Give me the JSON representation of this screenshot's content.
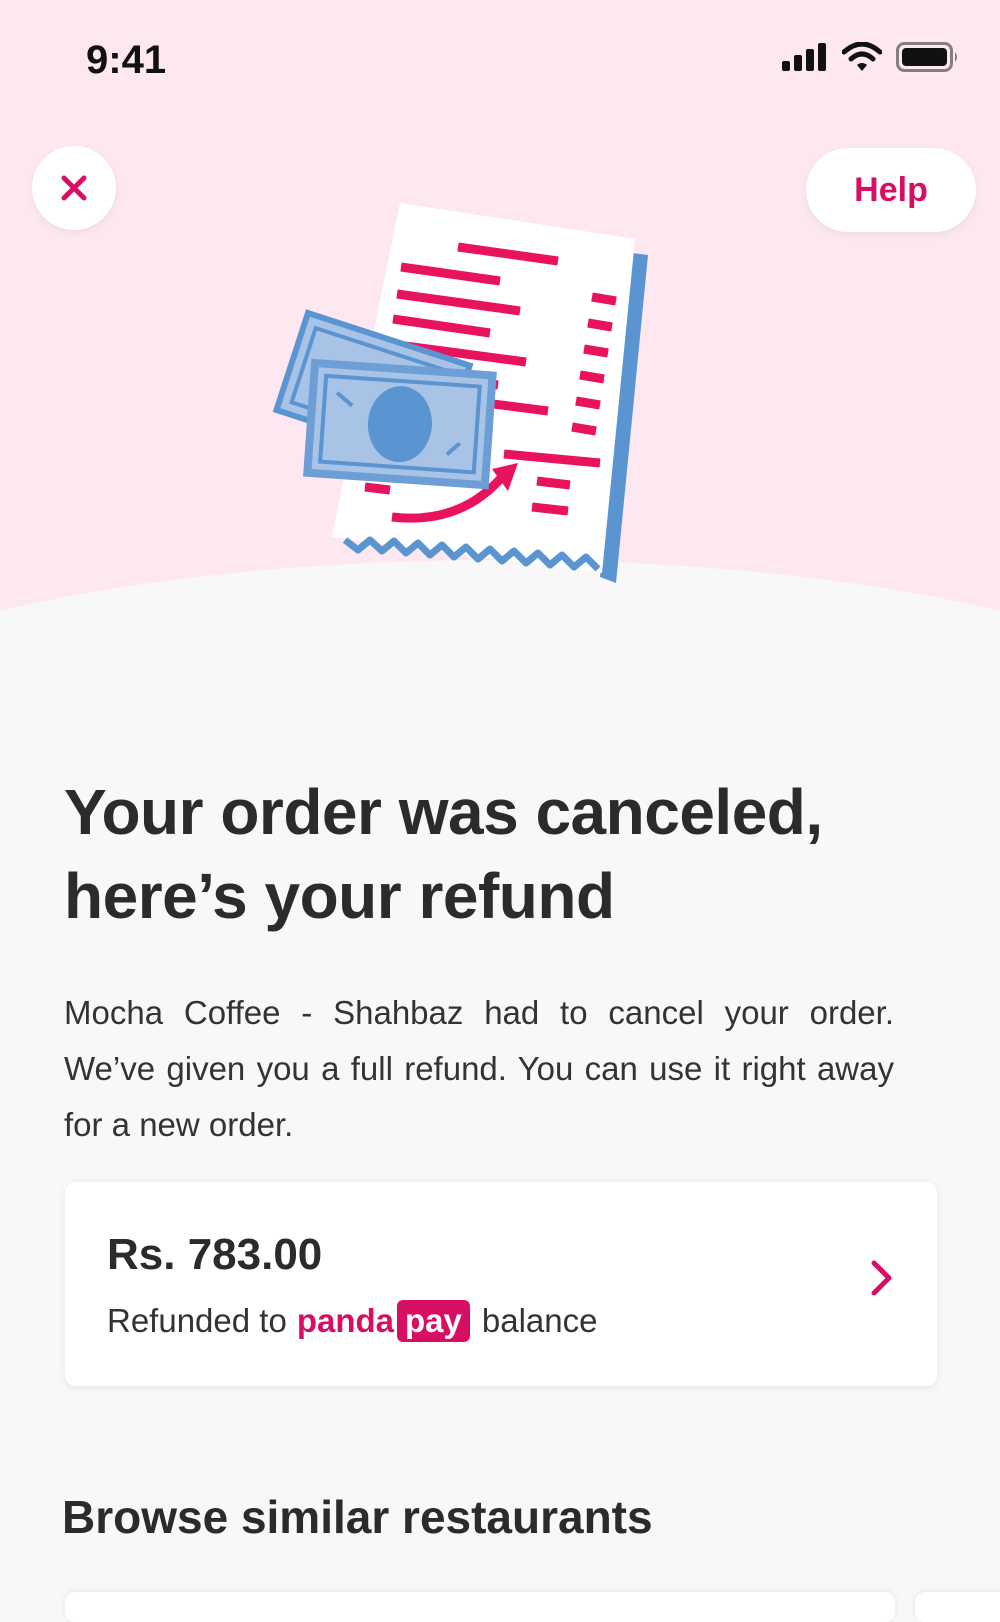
{
  "status_bar": {
    "time": "9:41"
  },
  "header": {
    "close_icon": "close-icon",
    "help_label": "Help"
  },
  "illustration": {
    "name": "receipt-refund-illustration"
  },
  "main": {
    "headline_line1": "Your order was canceled,",
    "headline_line2": "here’s your refund",
    "body": "Mocha Coffee - Shahbaz had to cancel your order. We’ve given you a full refund. You can use it right away for a new order."
  },
  "refund_card": {
    "amount": "Rs. 783.00",
    "prefix": "Refunded to",
    "brand_part1": "panda",
    "brand_part2": "pay",
    "suffix": "balance",
    "chevron_icon": "chevron-right-icon"
  },
  "browse": {
    "title": "Browse similar restaurants"
  },
  "colors": {
    "accent": "#d70f64",
    "hero_bg": "#fde8f1",
    "page_bg": "#f8f8f8",
    "illustration_blue": "#5a95d2"
  }
}
